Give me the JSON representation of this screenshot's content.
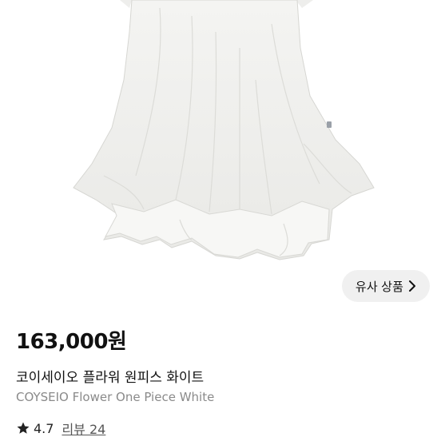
{
  "product": {
    "price": "163,000원",
    "name_ko": "코이세이오 플라워 원피스 화이트",
    "name_en": "COYSEIO Flower One Piece White",
    "rating": "4.7",
    "reviews_label": "리뷰 24"
  },
  "similar_button": {
    "label": "유사 상품"
  },
  "icons": {
    "star": "star-icon",
    "chevron": "chevron-right-icon"
  },
  "colors": {
    "background": "#ffffff",
    "button_bg": "#f0f0f0",
    "text": "#111111",
    "muted": "#8a8a8a"
  }
}
